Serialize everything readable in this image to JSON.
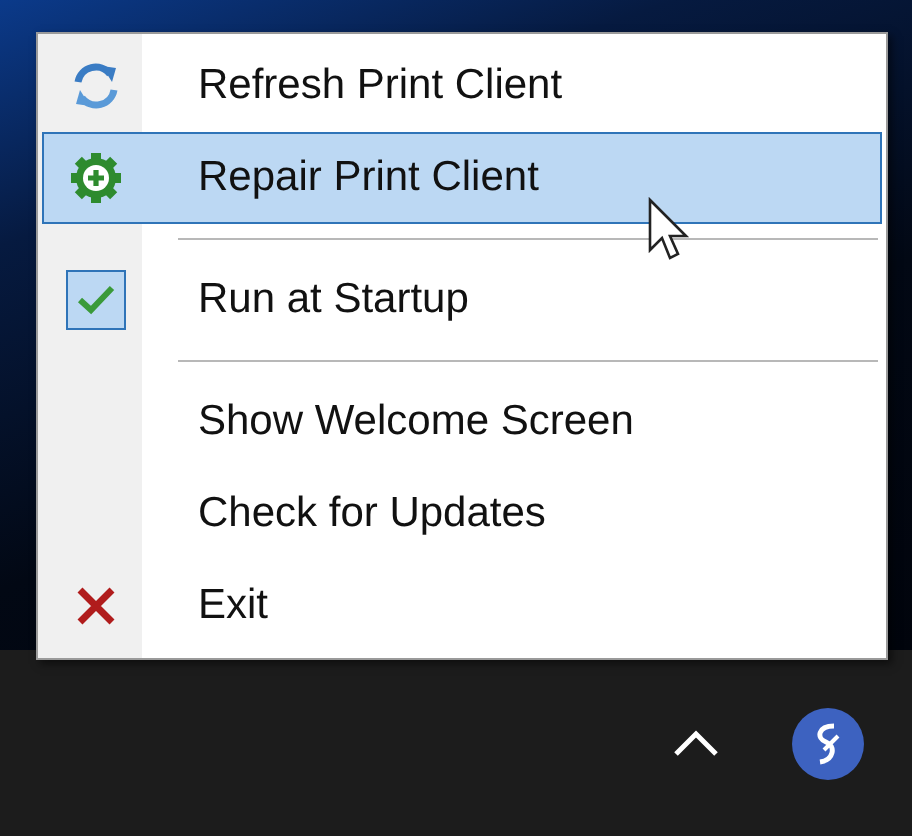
{
  "menu": {
    "items": [
      {
        "kind": "item",
        "label": "Refresh Print Client",
        "selected": false,
        "checked": false
      },
      {
        "kind": "item",
        "label": "Repair Print Client",
        "selected": true,
        "checked": false
      },
      {
        "kind": "separator"
      },
      {
        "kind": "item",
        "label": "Run at Startup",
        "selected": false,
        "checked": true
      },
      {
        "kind": "separator"
      },
      {
        "kind": "item",
        "label": "Show Welcome Screen",
        "selected": false,
        "checked": false
      },
      {
        "kind": "item",
        "label": "Check for Updates",
        "selected": false,
        "checked": false
      },
      {
        "kind": "item",
        "label": "Exit",
        "selected": false,
        "checked": false
      }
    ]
  }
}
